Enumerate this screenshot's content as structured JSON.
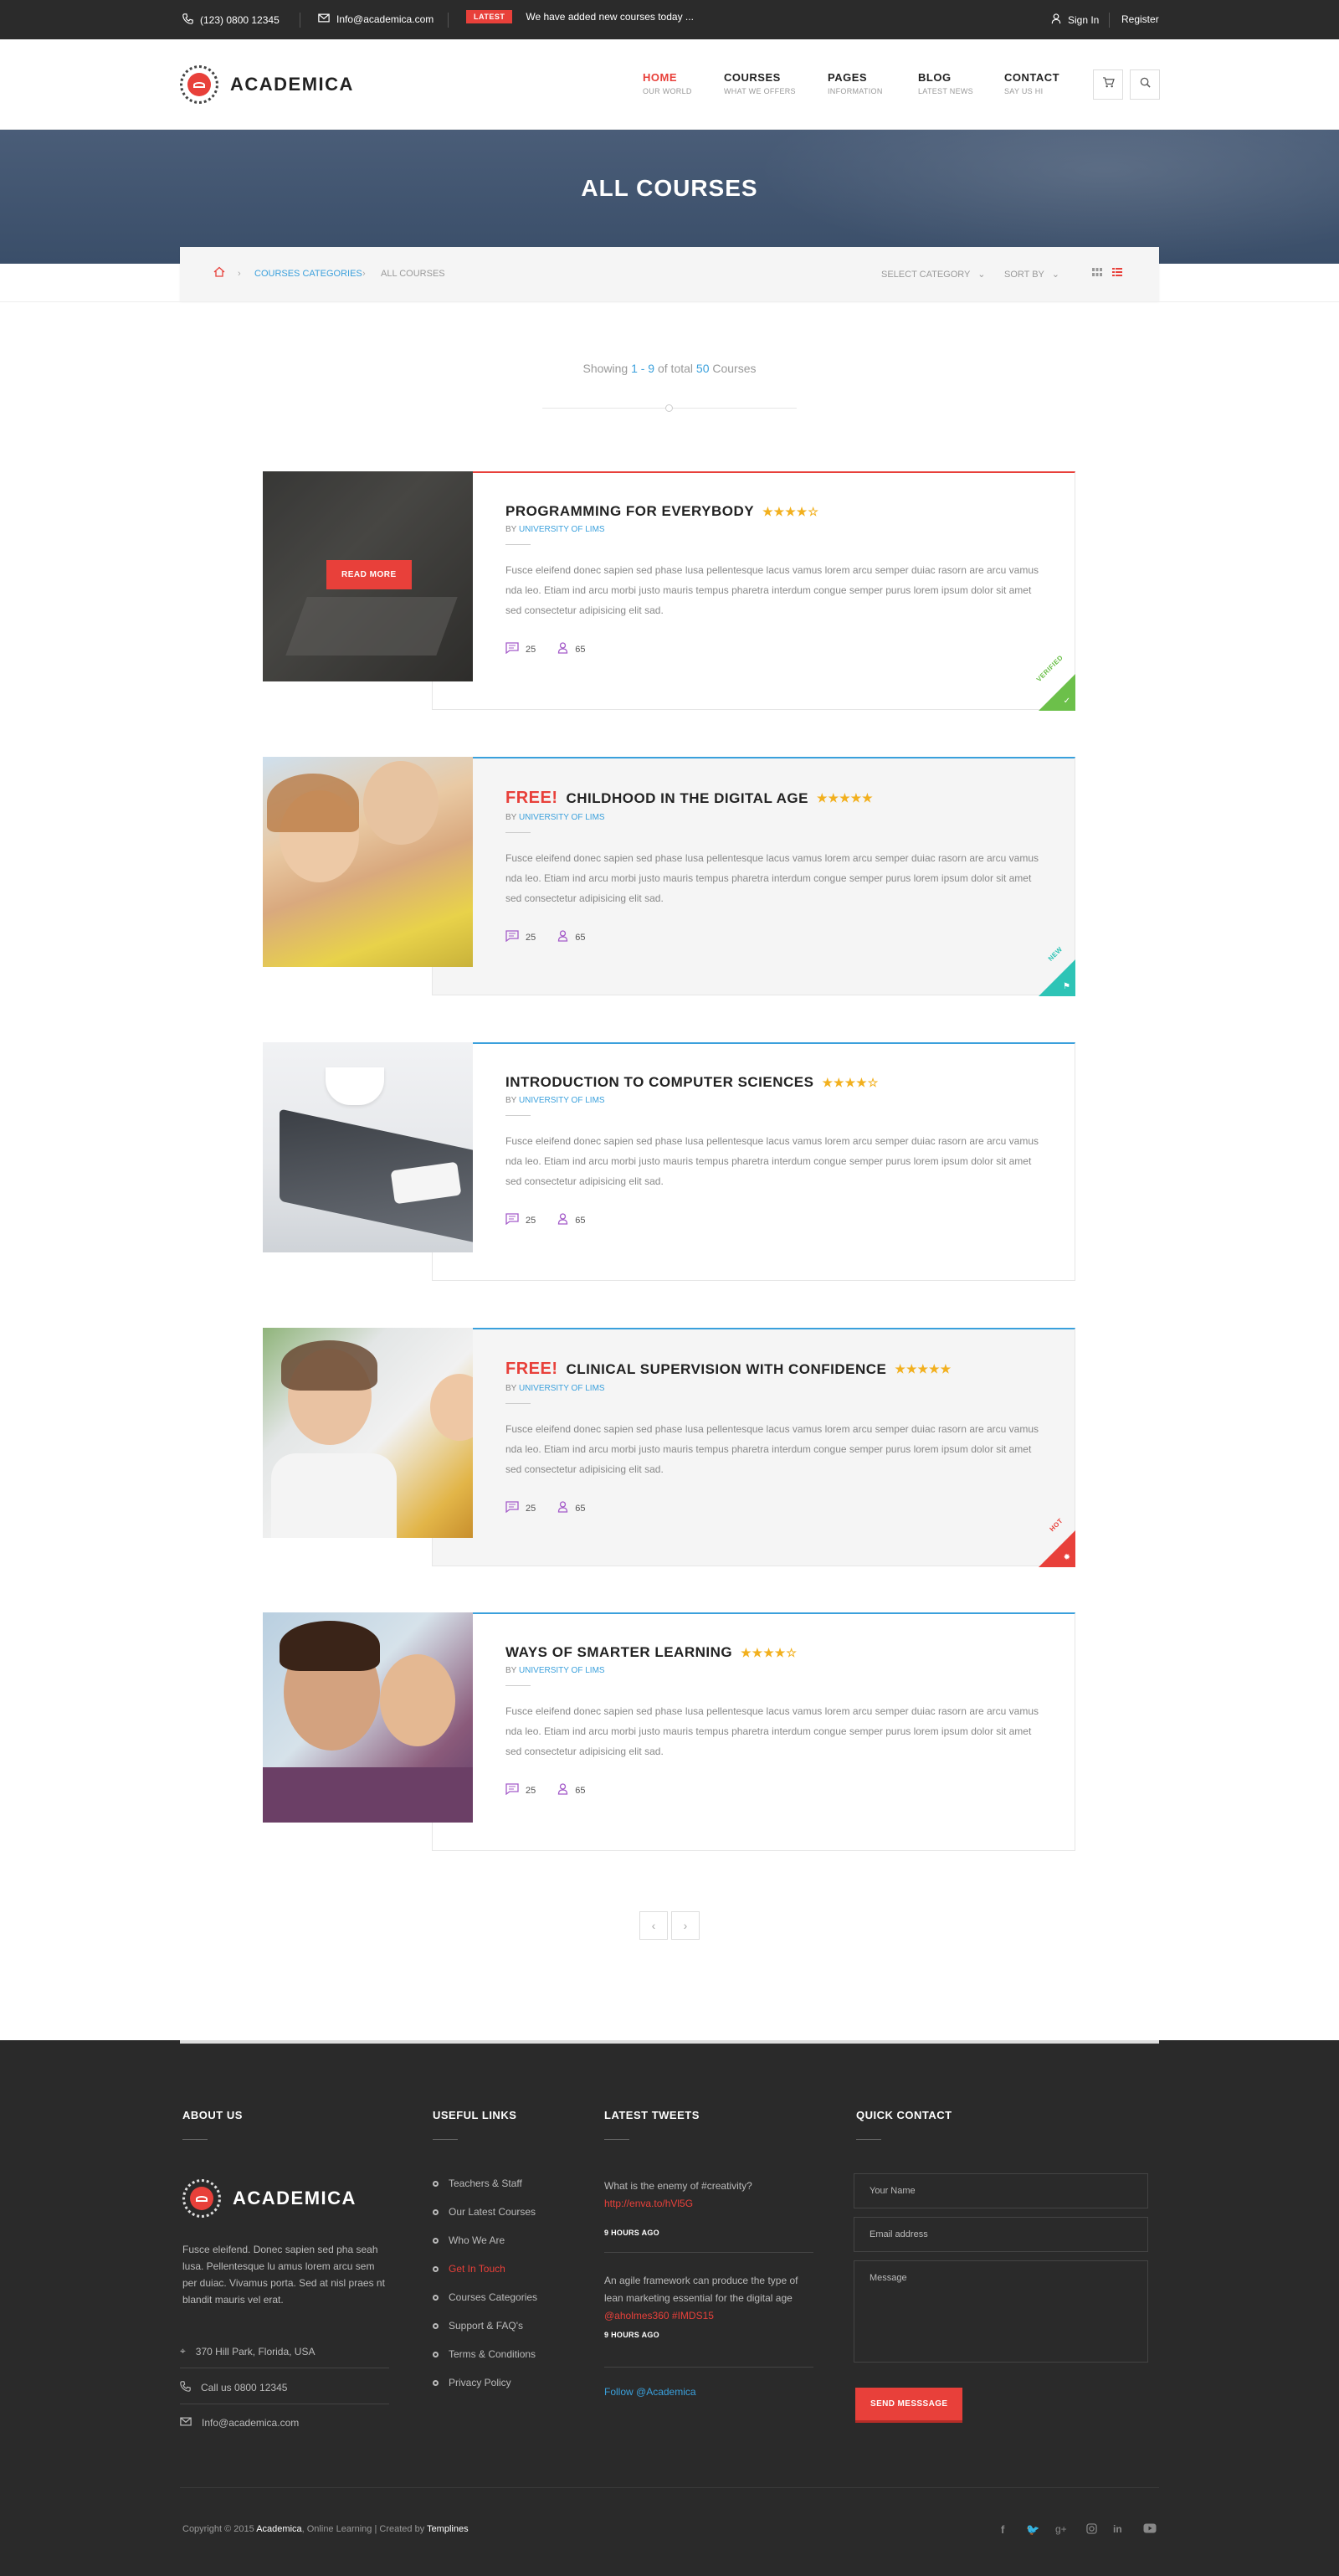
{
  "topbar": {
    "phone": "(123) 0800 12345",
    "email": "Info@academica.com",
    "latest_badge": "LATEST",
    "latest_text": "We have added new courses today ...",
    "signin": "Sign In",
    "register": "Register"
  },
  "header": {
    "logo_text": "ACADEMICA",
    "nav": [
      {
        "label": "HOME",
        "sub": "OUR WORLD"
      },
      {
        "label": "COURSES",
        "sub": "WHAT WE OFFERS"
      },
      {
        "label": "PAGES",
        "sub": "INFORMATION"
      },
      {
        "label": "BLOG",
        "sub": "LATEST NEWS"
      },
      {
        "label": "CONTACT",
        "sub": "SAY US HI"
      }
    ]
  },
  "hero": {
    "title": "ALL COURSES"
  },
  "breadcrumb": {
    "category": "COURSES CATEGORIES",
    "current": "ALL COURSES",
    "select_category": "SELECT CATEGORY",
    "sort_by": "SORT BY"
  },
  "showing": {
    "prefix": "Showing",
    "range": "1 - 9",
    "of": "of total",
    "total": "50",
    "suffix": "Courses"
  },
  "courses": [
    {
      "free": "",
      "title": "PROGRAMMING FOR EVERYBODY",
      "stars": "★★★★☆",
      "by": "BY",
      "uni": "UNIVERSITY OF LIMS",
      "desc": "Fusce eleifend donec sapien sed phase lusa pellentesque lacus vamus lorem arcu semper duiac rasorn are arcu vamus nda leo. Etiam ind arcu morbi justo mauris tempus pharetra interdum congue semper purus lorem ipsum dolor sit amet sed consectetur adipisicing elit sad.",
      "comments": "25",
      "students": "65",
      "ribbon": "VERIFIED",
      "read_more": "READ MORE"
    },
    {
      "free": "FREE!",
      "title": "CHILDHOOD IN THE DIGITAL AGE",
      "stars": "★★★★★",
      "by": "BY",
      "uni": "UNIVERSITY OF LIMS",
      "desc": "Fusce eleifend donec sapien sed phase lusa pellentesque lacus vamus lorem arcu semper duiac rasorn are arcu vamus nda leo. Etiam ind arcu morbi justo mauris tempus pharetra interdum congue semper purus lorem ipsum dolor sit amet sed consectetur adipisicing elit sad.",
      "comments": "25",
      "students": "65",
      "ribbon": "NEW"
    },
    {
      "free": "",
      "title": "INTRODUCTION TO COMPUTER SCIENCES",
      "stars": "★★★★☆",
      "by": "BY",
      "uni": "UNIVERSITY OF LIMS",
      "desc": "Fusce eleifend donec sapien sed phase lusa pellentesque lacus vamus lorem arcu semper duiac rasorn are arcu vamus nda leo. Etiam ind arcu morbi justo mauris tempus pharetra interdum congue semper purus lorem ipsum dolor sit amet sed consectetur adipisicing elit sad.",
      "comments": "25",
      "students": "65",
      "ribbon": ""
    },
    {
      "free": "FREE!",
      "title": "CLINICAL SUPERVISION WITH CONFIDENCE",
      "stars": "★★★★★",
      "by": "BY",
      "uni": "UNIVERSITY OF LIMS",
      "desc": "Fusce eleifend donec sapien sed phase lusa pellentesque lacus vamus lorem arcu semper duiac rasorn are arcu vamus nda leo. Etiam ind arcu morbi justo mauris tempus pharetra interdum congue semper purus lorem ipsum dolor sit amet sed consectetur adipisicing elit sad.",
      "comments": "25",
      "students": "65",
      "ribbon": "HOT"
    },
    {
      "free": "",
      "title": "WAYS OF SMARTER LEARNING",
      "stars": "★★★★☆",
      "by": "BY",
      "uni": "UNIVERSITY OF LIMS",
      "desc": "Fusce eleifend donec sapien sed phase lusa pellentesque lacus vamus lorem arcu semper duiac rasorn are arcu vamus nda leo. Etiam ind arcu morbi justo mauris tempus pharetra interdum congue semper purus lorem ipsum dolor sit amet sed consectetur adipisicing elit sad.",
      "comments": "25",
      "students": "65",
      "ribbon": ""
    }
  ],
  "pagination": {
    "prev": "‹",
    "next": "›"
  },
  "footer": {
    "about_title": "ABOUT US",
    "logo_text": "ACADEMICA",
    "about_text": "Fusce eleifend. Donec sapien sed pha seah lusa. Pellentesque lu amus lorem arcu sem per duiac. Vivamus porta. Sed at nisl praes nt blandit mauris vel erat.",
    "address": "370 Hill Park, Florida, USA",
    "call": "Call us 0800 12345",
    "email": "Info@academica.com",
    "links_title": "USEFUL LINKS",
    "links": [
      "Teachers & Staff",
      "Our Latest Courses",
      "Who We Are",
      "Get In Touch",
      "Courses Categories",
      "Support & FAQ's",
      "Terms & Conditions",
      "Privacy Policy"
    ],
    "tweets_title": "LATEST TWEETS",
    "tweet1_text": "What is the enemy of #creativity?",
    "tweet1_link": "http://enva.to/hVl5G",
    "tweet1_time": "9 HOURS AGO",
    "tweet2_text": "An agile framework can produce the type of lean marketing essential for the digital age",
    "tweet2_link": "@aholmes360 #IMDS15",
    "tweet2_time": "9 HOURS AGO",
    "follow": "Follow @Academica",
    "contact_title": "QUICK CONTACT",
    "name_ph": "Your Name",
    "email_ph": "Email address",
    "message_ph": "Message",
    "send": "SEND MESSSAGE",
    "copy_prefix": "Copyright © 2015",
    "copy_brand": "Academica",
    "copy_mid": ", Online Learning | Created by",
    "copy_author": "Templines"
  },
  "colors": {
    "accent": "#e8403a",
    "link": "#3aa0dc",
    "star": "#f2b01e",
    "footer_bg": "#2a2a2a",
    "topbar_bg": "#2b2b2b",
    "verified": "#6cc04a",
    "new": "#2ec4b6",
    "hot": "#e8403a"
  }
}
